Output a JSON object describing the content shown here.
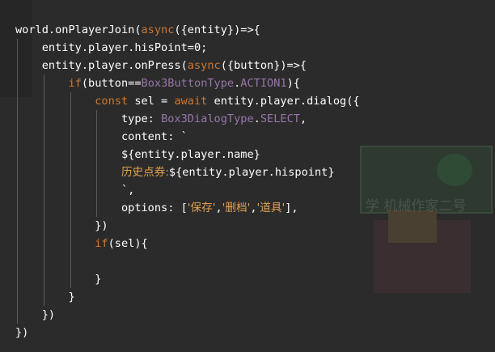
{
  "code": {
    "lines": [
      [
        {
          "t": "world.onPlayerJoin("
        },
        {
          "t": "async",
          "c": "kw"
        },
        {
          "t": "({entity})=>{"
        }
      ],
      [
        {
          "t": "    entity.player.hisPoint=0;"
        }
      ],
      [
        {
          "t": "    entity.player.onPress("
        },
        {
          "t": "async",
          "c": "kw"
        },
        {
          "t": "({button})=>{"
        }
      ],
      [
        {
          "t": "        "
        },
        {
          "t": "if",
          "c": "kw"
        },
        {
          "t": "(button=="
        },
        {
          "t": "Box3ButtonType",
          "c": "enum"
        },
        {
          "t": "."
        },
        {
          "t": "ACTION1",
          "c": "enum"
        },
        {
          "t": "){"
        }
      ],
      [
        {
          "t": "            "
        },
        {
          "t": "const",
          "c": "kw"
        },
        {
          "t": " sel = "
        },
        {
          "t": "await",
          "c": "kw"
        },
        {
          "t": " entity.player.dialog({"
        }
      ],
      [
        {
          "t": "                type: "
        },
        {
          "t": "Box3DialogType",
          "c": "enum"
        },
        {
          "t": "."
        },
        {
          "t": "SELECT",
          "c": "enum"
        },
        {
          "t": ","
        }
      ],
      [
        {
          "t": "                content: `"
        }
      ],
      [
        {
          "t": "                ${entity.player.name}"
        }
      ],
      [
        {
          "t": "                "
        },
        {
          "t": "历史点券:",
          "c": "cjk"
        },
        {
          "t": "${entity.player.hispoint}"
        }
      ],
      [
        {
          "t": "                `,"
        }
      ],
      [
        {
          "t": "                options: ["
        },
        {
          "t": "'保存'",
          "c": "str cjk"
        },
        {
          "t": ","
        },
        {
          "t": "'删档'",
          "c": "str cjk"
        },
        {
          "t": ","
        },
        {
          "t": "'道具'",
          "c": "str cjk"
        },
        {
          "t": "],"
        }
      ],
      [
        {
          "t": "            })"
        }
      ],
      [
        {
          "t": "            "
        },
        {
          "t": "if",
          "c": "kw"
        },
        {
          "t": "(sel){"
        }
      ],
      [
        {
          "t": ""
        }
      ],
      [
        {
          "t": "            }"
        }
      ],
      [
        {
          "t": "        }"
        }
      ],
      [
        {
          "t": "    })"
        }
      ],
      [
        {
          "t": "})"
        }
      ]
    ]
  },
  "watermark": "学 机械作家二号",
  "colors": {
    "background": "#2b2b2b",
    "keyword": "#cc7832",
    "enum": "#9876aa",
    "string": "#e0a050",
    "text": "#ffffff"
  }
}
